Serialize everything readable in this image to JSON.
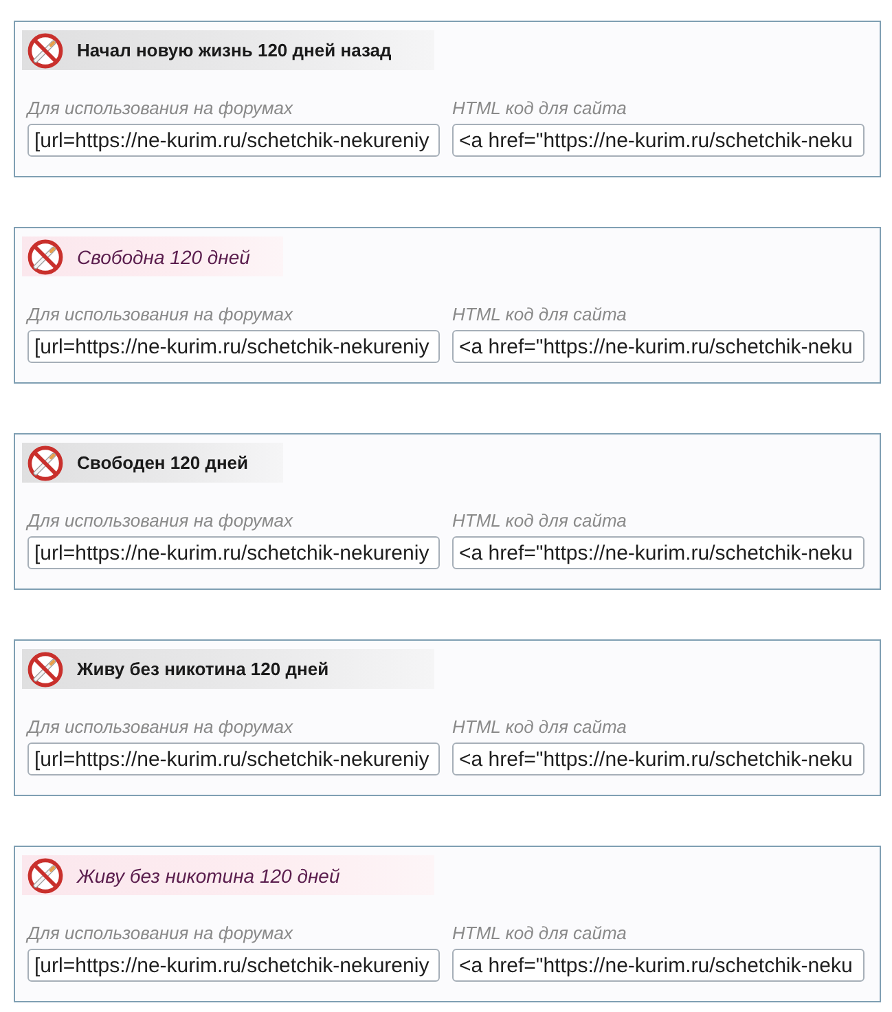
{
  "counters": [
    {
      "banner": {
        "kind": "neutral",
        "wide": true,
        "text": "Начал новую жизнь 120 дней назад"
      },
      "fields": [
        {
          "label": "Для использования на форумах",
          "value": "[url=https://ne-kurim.ru/schetchik-nekureniy"
        },
        {
          "label": "HTML код для сайта",
          "value": "<a href=\"https://ne-kurim.ru/schetchik-neku"
        }
      ]
    },
    {
      "banner": {
        "kind": "feminine",
        "wide": false,
        "text": "Свободна 120 дней"
      },
      "fields": [
        {
          "label": "Для использования на форумах",
          "value": "[url=https://ne-kurim.ru/schetchik-nekureniy"
        },
        {
          "label": "HTML код для сайта",
          "value": "<a href=\"https://ne-kurim.ru/schetchik-neku"
        }
      ]
    },
    {
      "banner": {
        "kind": "neutral",
        "wide": false,
        "text": "Свободен 120 дней"
      },
      "fields": [
        {
          "label": "Для использования на форумах",
          "value": "[url=https://ne-kurim.ru/schetchik-nekureniy"
        },
        {
          "label": "HTML код для сайта",
          "value": "<a href=\"https://ne-kurim.ru/schetchik-neku"
        }
      ]
    },
    {
      "banner": {
        "kind": "neutral",
        "wide": true,
        "text": "Живу без никотина 120 дней"
      },
      "fields": [
        {
          "label": "Для использования на форумах",
          "value": "[url=https://ne-kurim.ru/schetchik-nekureniy"
        },
        {
          "label": "HTML код для сайта",
          "value": "<a href=\"https://ne-kurim.ru/schetchik-neku"
        }
      ]
    },
    {
      "banner": {
        "kind": "feminine",
        "wide": true,
        "text": "Живу без никотина 120 дней"
      },
      "fields": [
        {
          "label": "Для использования на форумах",
          "value": "[url=https://ne-kurim.ru/schetchik-nekureniy"
        },
        {
          "label": "HTML код для сайта",
          "value": "<a href=\"https://ne-kurim.ru/schetchik-neku"
        }
      ]
    }
  ]
}
